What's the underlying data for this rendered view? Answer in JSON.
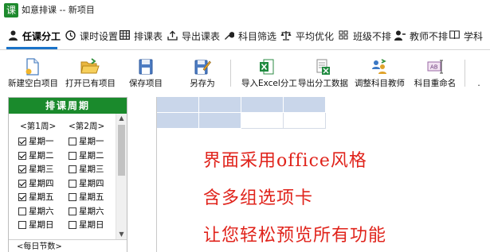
{
  "window": {
    "app_icon_text": "课",
    "title": "如意排课 -- 新项目"
  },
  "tabs": [
    {
      "label": "任课分工",
      "icon": "person-icon",
      "active": true
    },
    {
      "label": "课时设置",
      "icon": "clock-icon"
    },
    {
      "label": "排课表",
      "icon": "table-icon"
    },
    {
      "label": "导出课表",
      "icon": "export-icon"
    },
    {
      "label": "科目筛选",
      "icon": "wrench-icon"
    },
    {
      "label": "平均优化",
      "icon": "balance-icon"
    },
    {
      "label": "班级不排",
      "icon": "grid-dots-icon"
    },
    {
      "label": "教师不排",
      "icon": "person-minus-icon"
    },
    {
      "label": "学科",
      "icon": "book-icon"
    }
  ],
  "toolbar": {
    "new_blank": "新建空白项目",
    "open_existing": "打开已有项目",
    "save_project": "保存项目",
    "save_as": "另存为",
    "import_excel": "导入Excel分工",
    "export_data": "导出分工数据",
    "adjust_teacher": "调整科目教师",
    "rename_subject": "科目重命名",
    "more": "."
  },
  "schedule_panel": {
    "header": "排课周期",
    "week1_label": "<第1周>",
    "week2_label": "<第2周>",
    "week1_days": [
      {
        "label": "星期一",
        "checked": true
      },
      {
        "label": "星期二",
        "checked": true
      },
      {
        "label": "星期三",
        "checked": true
      },
      {
        "label": "星期四",
        "checked": true
      },
      {
        "label": "星期五",
        "checked": true
      },
      {
        "label": "星期六",
        "checked": false
      },
      {
        "label": "星期日",
        "checked": false
      }
    ],
    "week2_days": [
      {
        "label": "星期一",
        "checked": false
      },
      {
        "label": "星期二",
        "checked": false
      },
      {
        "label": "星期三",
        "checked": false
      },
      {
        "label": "星期四",
        "checked": false
      },
      {
        "label": "星期五",
        "checked": false
      },
      {
        "label": "星期六",
        "checked": false
      },
      {
        "label": "星期日",
        "checked": false
      }
    ],
    "footer": "<每日节数>"
  },
  "main": {
    "promo_lines": [
      "界面采用office风格",
      "含多组选项卡",
      "让您轻松预览所有功能"
    ]
  },
  "colors": {
    "accent_green": "#1a8a2c",
    "tab_underline": "#1a73c9",
    "grid_fill": "#c9d6ea",
    "promo_red": "#e0231b"
  }
}
